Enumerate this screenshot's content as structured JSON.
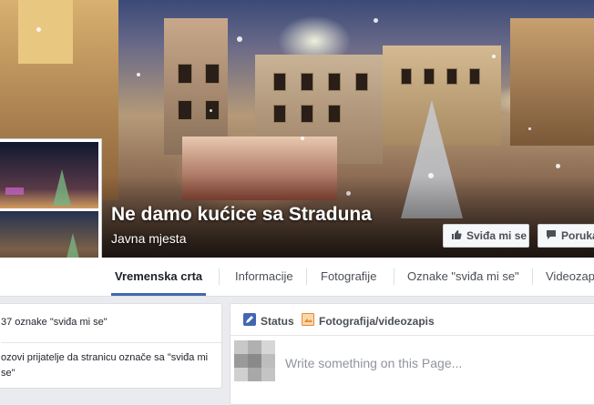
{
  "page": {
    "name": "Ne damo kućice sa Straduna",
    "category": "Javna mjesta"
  },
  "cover_buttons": {
    "like_label": "Sviđa mi se",
    "message_label": "Poruka"
  },
  "tabs": [
    {
      "label": "Vremenska crta"
    },
    {
      "label": "Informacije"
    },
    {
      "label": "Fotografije"
    },
    {
      "label": "Oznake \"sviđa mi se\""
    },
    {
      "label": "Videozapisi"
    }
  ],
  "left_card": {
    "likes_text": "37 oznake \"sviđa mi se\"",
    "invite_text": "ozovi prijatelje da stranicu označe sa \"sviđa mi se\""
  },
  "composer": {
    "status_label": "Status",
    "photo_label": "Fotografija/videozapis",
    "placeholder": "Write something on this Page..."
  },
  "colors": {
    "accent": "#4267b2",
    "background": "#e9ebee"
  },
  "icons": [
    "thumbs-up-icon",
    "message-icon",
    "pencil-icon",
    "photo-icon"
  ]
}
